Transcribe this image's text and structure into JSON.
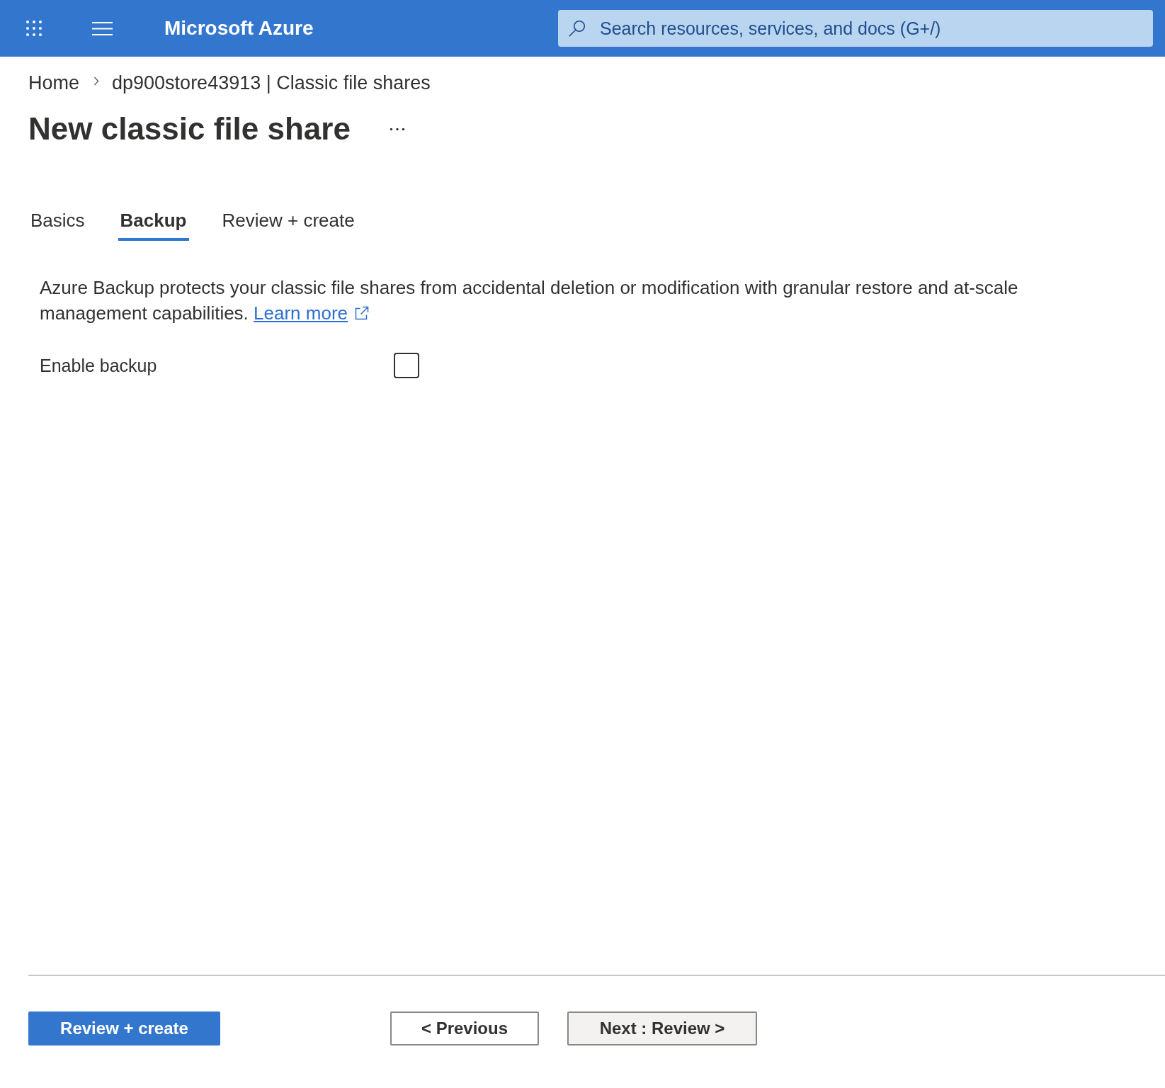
{
  "top_bar": {
    "brand": "Microsoft Azure",
    "search": {
      "placeholder": "Search resources, services, and docs (G+/)"
    }
  },
  "breadcrumb": [
    {
      "label": "Home"
    },
    {
      "label": "dp900store43913 | Classic file shares"
    }
  ],
  "title": "New classic file share",
  "tabs": [
    {
      "label": "Basics",
      "selected": false
    },
    {
      "label": "Backup",
      "selected": true
    },
    {
      "label": "Review + create",
      "selected": false
    }
  ],
  "description": {
    "text": "Azure Backup protects your classic file shares from accidental deletion or modification with granular restore and at-scale management capabilities.",
    "link": "Learn more"
  },
  "fields": [
    {
      "kind": "checkbox",
      "label": "Enable backup",
      "checked": false
    }
  ],
  "footer_buttons": [
    {
      "kind": "primary",
      "label": "Review + create"
    },
    {
      "kind": "back",
      "label": "< Previous"
    },
    {
      "kind": "next",
      "label": "Next : Review >"
    }
  ]
}
